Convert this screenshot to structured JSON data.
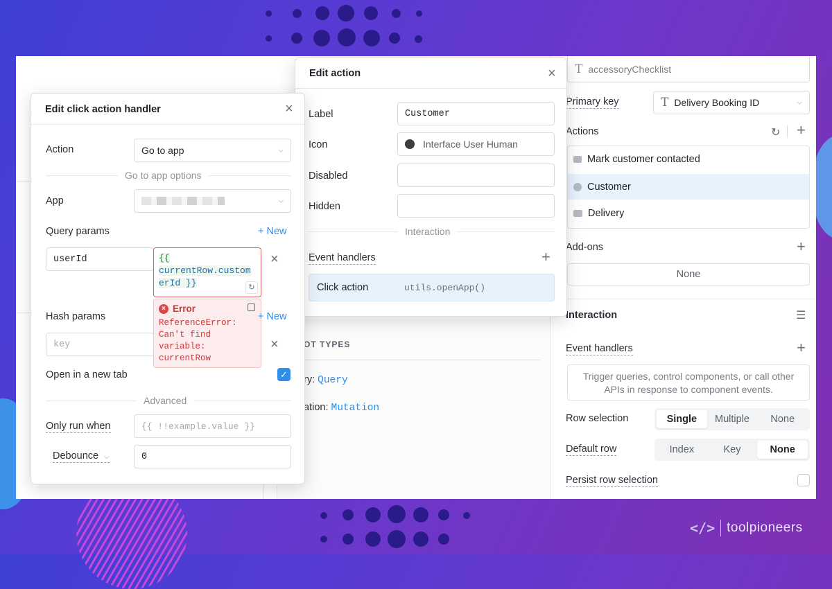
{
  "click_handler": {
    "title": "Edit click action handler",
    "action_label": "Action",
    "action_value": "Go to app",
    "options_section": "Go to app options",
    "app_label": "App",
    "query_params_label": "Query params",
    "new_label": "+ New",
    "query_key": "userId",
    "query_value_line1": "{{",
    "query_value_line2": "currentRow.custom",
    "query_value_line3": "erId }}",
    "error_title": "Error",
    "error_message": "ReferenceError: Can't find variable: currentRow",
    "hash_params_label": "Hash params",
    "hash_key_placeholder": "key",
    "new_tab_label": "Open in a new tab",
    "new_tab_checked": true,
    "advanced_section": "Advanced",
    "only_run_label": "Only run when",
    "only_run_placeholder": "{{ !!example.value }}",
    "debounce_label": "Debounce",
    "debounce_value": "0"
  },
  "edit_action": {
    "title": "Edit action",
    "label_label": "Label",
    "label_value": "Customer",
    "icon_label": "Icon",
    "icon_value": "Interface User Human",
    "disabled_label": "Disabled",
    "hidden_label": "Hidden",
    "interaction_section": "Interaction",
    "event_handlers_label": "Event handlers",
    "handler_name": "Click action",
    "handler_code": "utils.openApp()"
  },
  "background": {
    "types_heading": "OT TYPES",
    "query_prefix": "ry:",
    "query_link": "Query",
    "mutation_prefix": "ation:",
    "mutation_link": "Mutation"
  },
  "inspector": {
    "top_field": "accessoryChecklist",
    "primary_key_label": "Primary key",
    "primary_key_value": "Delivery Booking ID",
    "actions_label": "Actions",
    "actions": [
      "Mark customer contacted",
      "Customer",
      "Delivery"
    ],
    "addons_label": "Add-ons",
    "addons_value": "None",
    "interaction_heading": "Interaction",
    "event_handlers_label": "Event handlers",
    "event_handlers_empty": "Trigger queries, control components, or call other APIs in response to component events.",
    "row_selection_label": "Row selection",
    "row_selection_options": [
      "Single",
      "Multiple",
      "None"
    ],
    "default_row_label": "Default row",
    "default_row_options": [
      "Index",
      "Key",
      "None"
    ],
    "persist_label": "Persist row selection"
  },
  "brand": {
    "name": "toolpioneers"
  }
}
